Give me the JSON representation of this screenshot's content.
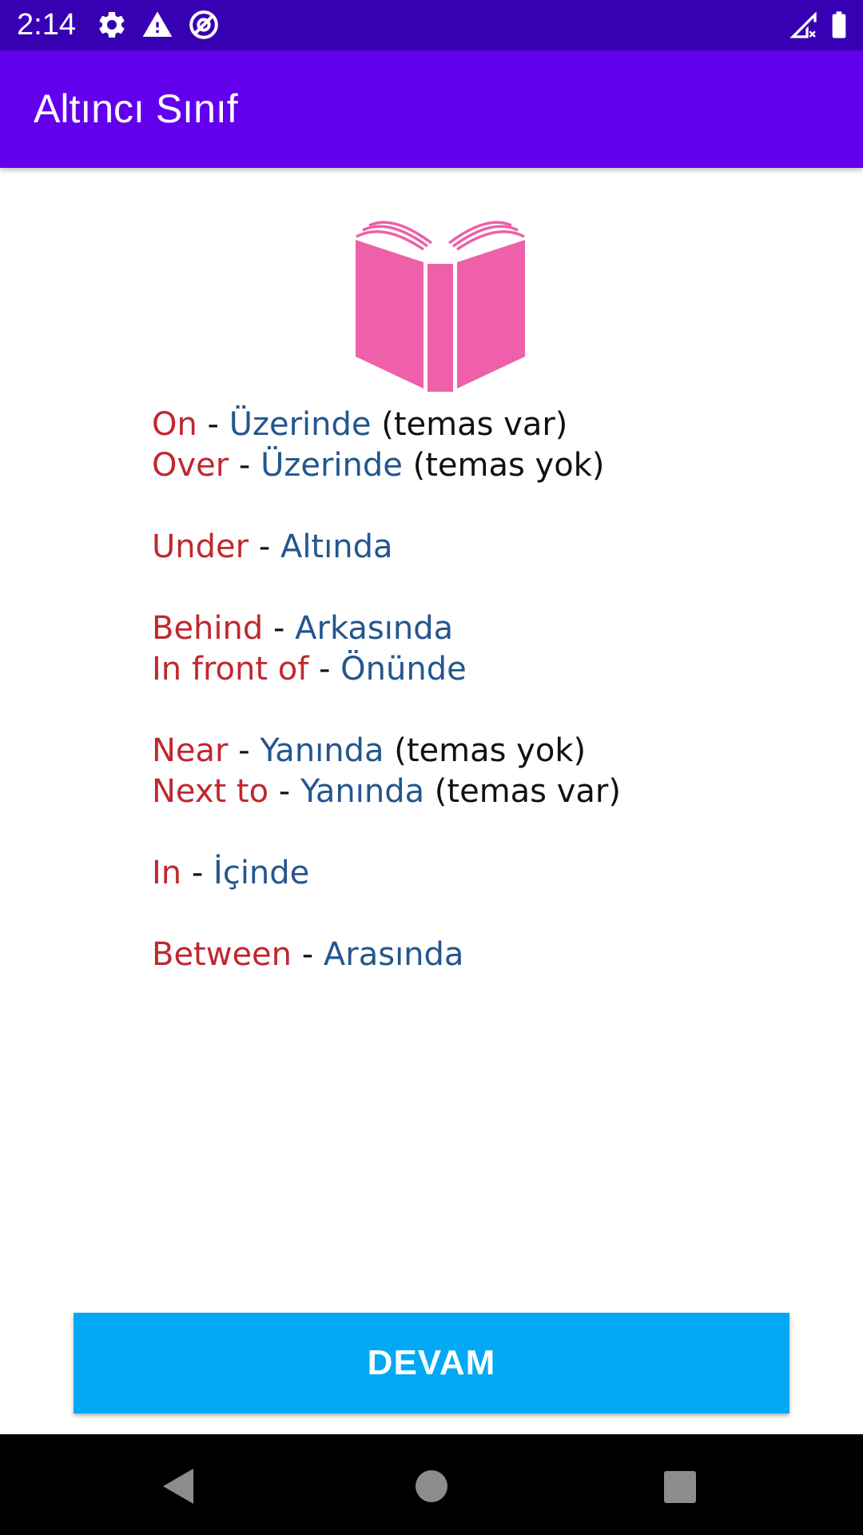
{
  "status_bar": {
    "time": "2:14",
    "icons": [
      "gear-icon",
      "warning-icon",
      "no-tracking-icon",
      "signal-off-icon",
      "battery-icon"
    ]
  },
  "app_bar": {
    "title": "Altıncı Sınıf"
  },
  "illustration": {
    "icon": "open-book-icon",
    "color": "#EE60AA"
  },
  "lesson": {
    "colors": {
      "english": "#C0282E",
      "turkish": "#23568E",
      "note": "#111111"
    },
    "groups": [
      [
        {
          "en": "On",
          "sep": " - ",
          "tr": "Üzerinde",
          "note": " (temas var)"
        },
        {
          "en": "Over",
          "sep": " - ",
          "tr": "Üzerinde",
          "note": " (temas yok)"
        }
      ],
      [
        {
          "en": "Under",
          "sep": " - ",
          "tr": "Altında",
          "note": ""
        }
      ],
      [
        {
          "en": "Behind",
          "sep": " - ",
          "tr": "Arkasında",
          "note": ""
        },
        {
          "en": "In front of",
          "sep": " - ",
          "tr": "Önünde",
          "note": ""
        }
      ],
      [
        {
          "en": "Near",
          "sep": " - ",
          "tr": "Yanında",
          "note": " (temas yok)"
        },
        {
          "en": "Next to",
          "sep": " - ",
          "tr": "Yanında",
          "note": " (temas var)"
        }
      ],
      [
        {
          "en": "In",
          "sep": " - ",
          "tr": "İçinde",
          "note": ""
        }
      ],
      [
        {
          "en": "Between",
          "sep": " - ",
          "tr": "Arasında",
          "note": ""
        }
      ]
    ]
  },
  "continue_button": {
    "label": "DEVAM",
    "color": "#03A9F4"
  },
  "nav_bar": {
    "buttons": [
      "back-icon",
      "home-icon",
      "recents-icon"
    ]
  }
}
